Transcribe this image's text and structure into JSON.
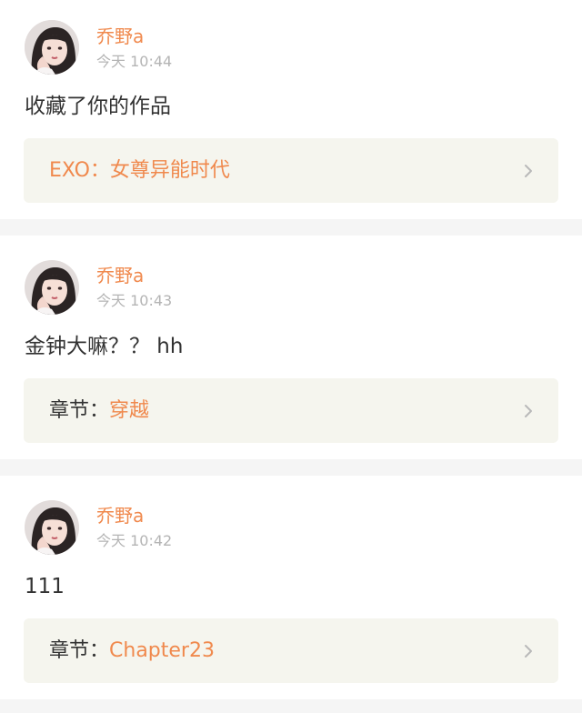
{
  "colors": {
    "accent": "#f0894d",
    "timestamp": "#b4b4b4",
    "text": "#333333",
    "link_box_bg": "#f5f5ee",
    "page_bg": "#f5f5f5"
  },
  "notifications": [
    {
      "username": "乔野a",
      "timestamp": "今天 10:44",
      "message": "收藏了你的作品",
      "link": {
        "prefix": "",
        "value": "EXO：女尊异能时代",
        "icon": "chevron-right-icon"
      }
    },
    {
      "username": "乔野a",
      "timestamp": "今天 10:43",
      "message": "金钟大嘛？？ hh",
      "link": {
        "prefix": "章节：",
        "value": "穿越",
        "icon": "chevron-right-icon"
      }
    },
    {
      "username": "乔野a",
      "timestamp": "今天 10:42",
      "message": "111",
      "link": {
        "prefix": "章节：",
        "value": "Chapter23",
        "icon": "chevron-right-icon"
      }
    }
  ]
}
